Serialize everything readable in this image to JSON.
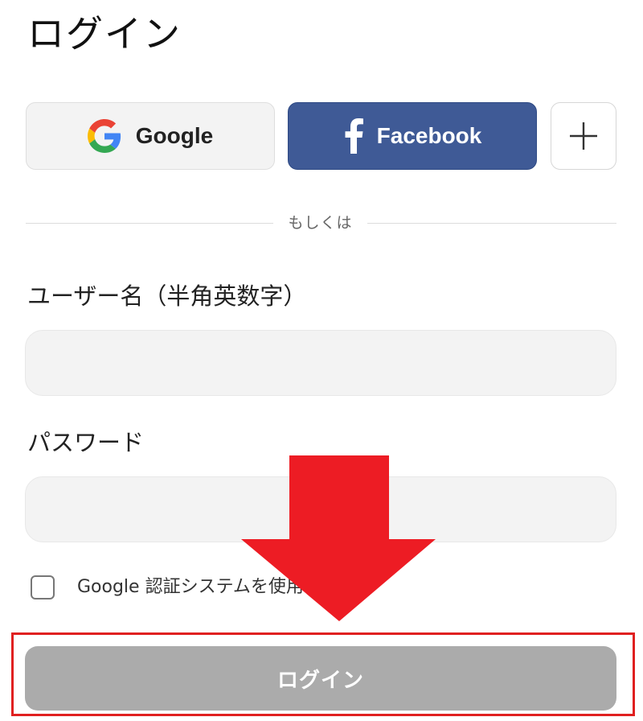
{
  "page": {
    "title": "ログイン"
  },
  "social": {
    "google_label": "Google",
    "facebook_label": "Facebook",
    "more_symbol": "+"
  },
  "divider": {
    "text": "もしくは"
  },
  "form": {
    "username_label": "ユーザー名（半角英数字）",
    "username_value": "",
    "password_label": "パスワード",
    "password_value": "",
    "two_factor_label": "Google 認証システムを使用",
    "two_factor_checked": false
  },
  "actions": {
    "login_label": "ログイン"
  },
  "annotation": {
    "arrow_color": "#ED1C24",
    "highlight_color": "#E02020"
  },
  "colors": {
    "facebook": "#3F5A96",
    "login_button": "#ABABAB",
    "input_bg": "#F3F3F3"
  },
  "icons": {
    "google": "google-logo-icon",
    "facebook": "facebook-f-icon",
    "more": "plus-icon",
    "arrow": "down-arrow-icon"
  }
}
